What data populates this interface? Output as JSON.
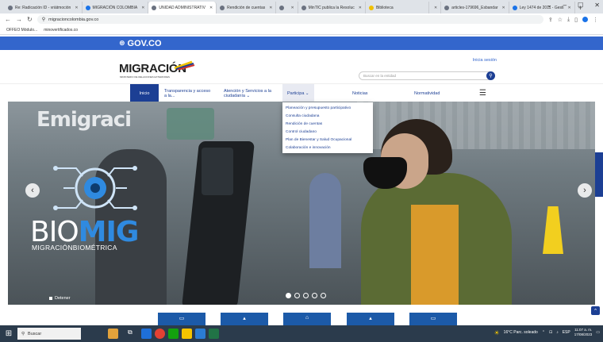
{
  "browser": {
    "tabs": [
      {
        "label": "Re: Radicación ID - vriátmoción"
      },
      {
        "label": "MIGRACIÓN COLOMBIA"
      },
      {
        "label": "UNIDAD ADMINISTRATIV"
      },
      {
        "label": "Rendición de cuentas"
      },
      {
        "label": ""
      },
      {
        "label": "MinTIC publica la Resoluc"
      },
      {
        "label": "Biblioteca"
      },
      {
        "label": ""
      },
      {
        "label": "articles-179696_Esbandar"
      },
      {
        "label": "Ley 1474 de 2011 - Gesti"
      }
    ],
    "url": "migracioncolombia.gov.co",
    "bookmarks": [
      "OFFEO Módulo...",
      "minovertificados.co"
    ]
  },
  "gov_bar": {
    "label": "GOV.CO"
  },
  "header": {
    "logo": "MIGRACIÓN",
    "logo_sub": "MINISTERIO DE RELACIONES EXTERIORES",
    "login": "Inicia sesión",
    "search_placeholder": "Buscar en la entidad"
  },
  "nav": {
    "home": "Inicio",
    "transparencia": "Transparencia y acceso a la...",
    "atencion": "Atención y Servicios a la ciudadanía ⌄",
    "participa": "Participa ⌄",
    "noticias": "Noticias",
    "normatividad": "Normatividad"
  },
  "dropdown": [
    "Planeación y presupuesto participativo",
    "Consulta ciudadana",
    "Rendición de cuentas",
    "Control ciudadano",
    "Plan de Bienestar y Salud Ocupacional",
    "Colaboración e innovación"
  ],
  "hero": {
    "sign_text": "Emigraci",
    "brand_a": "BIO",
    "brand_b": "MIG",
    "brand_sub": "MIGRACIÓNBIOMÉTRICA",
    "stop_label": "Detener",
    "slide_count": 5,
    "active_slide": 1
  },
  "taskbar": {
    "search": "Buscar",
    "weather": "16°C  Parc. soleado",
    "tray_lang": "ESP",
    "time": "11:07 a. m.",
    "date": "17/08/2023"
  },
  "colors": {
    "gov_blue": "#3366cc",
    "brand_navy": "#1c3f94",
    "tile_blue": "#1c5aa8"
  }
}
